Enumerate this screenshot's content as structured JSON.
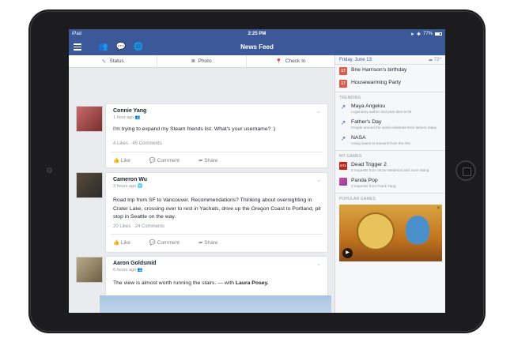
{
  "statusbar": {
    "device": "iPad",
    "wifi_icon": "wifi-icon",
    "time": "2:25 PM",
    "battery": "77%"
  },
  "nav": {
    "title": "News Feed",
    "icons": [
      "friends-icon",
      "messages-icon",
      "globe-icon"
    ]
  },
  "composer": {
    "status": "Status",
    "photo": "Photo",
    "checkin": "Check In"
  },
  "posts": [
    {
      "name": "Connie Yang",
      "time": "1 hour ago",
      "text": "I'm trying to expand my Steam friends list. What's your username? :)",
      "likes": "4 Likes",
      "comments": "45 Comments"
    },
    {
      "name": "Cameron Wu",
      "time": "3 hours ago",
      "text": "Road trip from SF to Vancouver. Recommendations? Thinking about overnighting in Crater Lake, crossing over to rest in Yachats, drive up the Oregon Coast to Portland, pit stop in Seattle on the way.",
      "likes": "20 Likes",
      "comments": "24 Comments"
    },
    {
      "name": "Aaron Goldsmid",
      "time": "6 hours ago",
      "text": "The view is almost worth running the stairs. — with",
      "tag": "Laura Posey."
    }
  ],
  "actions": {
    "like": "Like",
    "comment": "Comment",
    "share": "Share"
  },
  "sidebar": {
    "date": "Friday, June 13",
    "weather": "72°",
    "events": [
      {
        "title": "Brie Harrison's birthday"
      },
      {
        "title": "Housewarming Party"
      }
    ],
    "trending_header": "TRENDING",
    "trending": [
      {
        "title": "Maya Angelou",
        "sub": "Legendary author and poet dies at 86"
      },
      {
        "title": "Father's Day",
        "sub": "People around the world celebrate their fathers today"
      },
      {
        "title": "NASA",
        "sub": "Using lasers to transmit from the ISS"
      }
    ],
    "games_header": "MY GAMES",
    "games": [
      {
        "title": "Dead Trigger 2",
        "sub": "6 requests from Victor Medeiros and June Wang"
      },
      {
        "title": "Panda Pop",
        "sub": "3 requests from Frank Yang"
      }
    ],
    "popular_header": "POPULAR GAMES"
  }
}
